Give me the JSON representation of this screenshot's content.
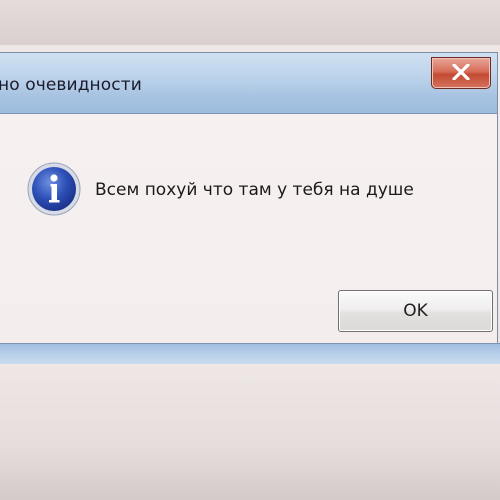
{
  "window": {
    "title": "но очевидности"
  },
  "message": {
    "text": "Всем похуй что там у тебя на душе"
  },
  "buttons": {
    "ok_label": "OK",
    "close_glyph": "X"
  },
  "icons": {
    "info": "information-icon",
    "close": "close-icon"
  },
  "colors": {
    "titlebar": "#bfd5ec",
    "close_button": "#d4735f",
    "info_icon": "#2f55b8"
  }
}
